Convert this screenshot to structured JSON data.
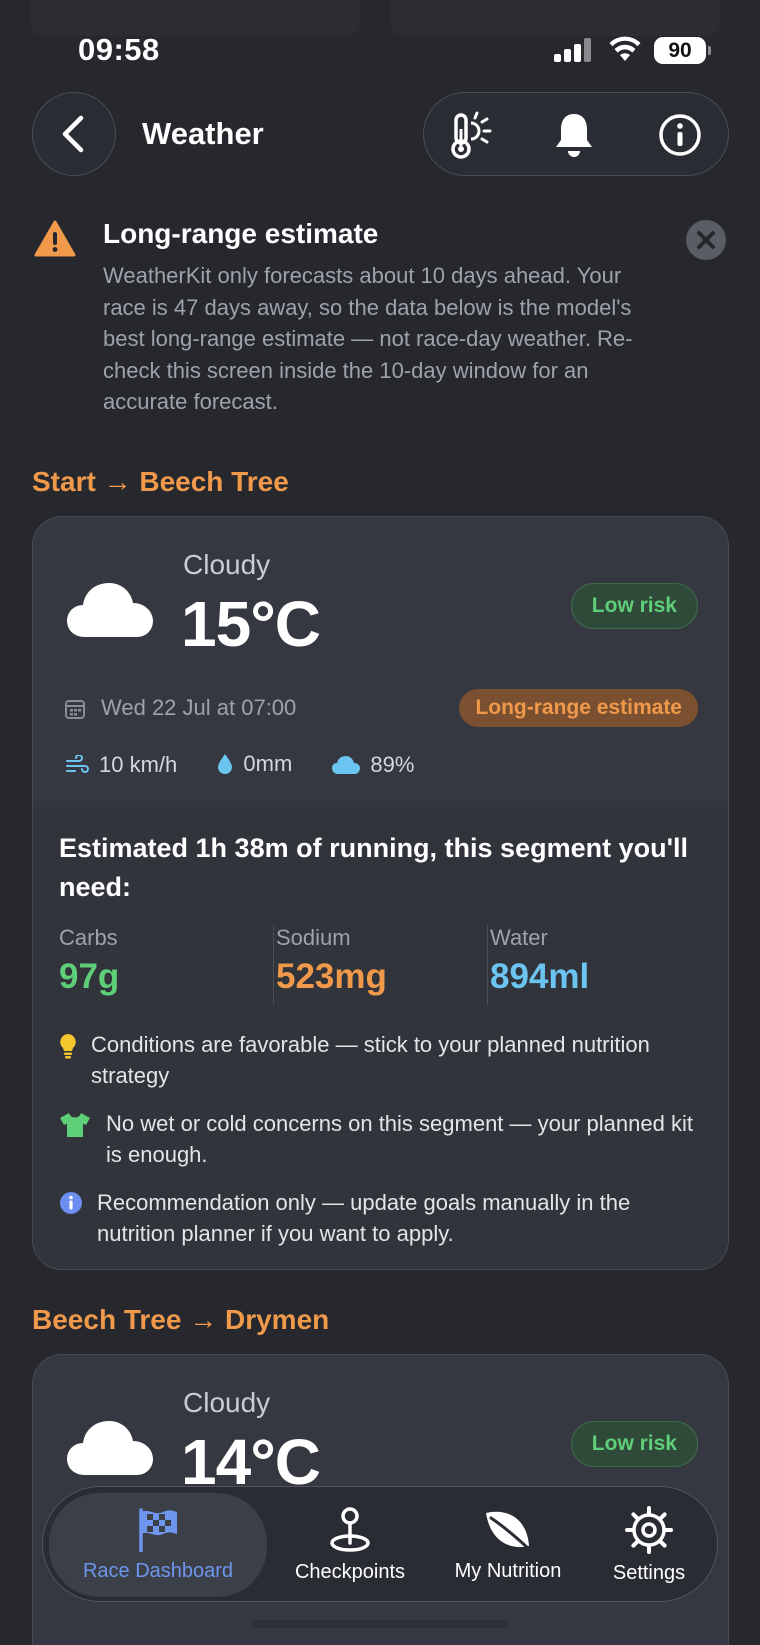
{
  "status_bar": {
    "time": "09:58",
    "battery": "90"
  },
  "header": {
    "title": "Weather"
  },
  "alert": {
    "title": "Long-range estimate",
    "body": "WeatherKit only forecasts about 10 days ahead. Your race is 47 days away, so the data below is the model's best long-range estimate — not race-day weather. Re-check this screen inside the 10-day window for an accurate forecast."
  },
  "segments": [
    {
      "heading": "Start → Beech Tree",
      "condition": "Cloudy",
      "temperature": "15°C",
      "risk": "Low risk",
      "datetime": "Wed 22 Jul at 07:00",
      "estimate_badge": "Long-range estimate",
      "wind": "10 km/h",
      "precip": "0mm",
      "cloud_cover": "89%",
      "estimate_text": "Estimated 1h 38m of running, this segment you'll need:",
      "nutrition": [
        {
          "label": "Carbs",
          "value": "97g",
          "color": "#5fce78"
        },
        {
          "label": "Sodium",
          "value": "523mg",
          "color": "#f0994a"
        },
        {
          "label": "Water",
          "value": "894ml",
          "color": "#6cc4f0"
        }
      ],
      "tips": [
        {
          "icon": "lightbulb-icon",
          "text": "Conditions are favorable — stick to your planned nutrition strategy"
        },
        {
          "icon": "tshirt-icon",
          "text": "No wet or cold concerns on this segment — your planned kit is enough."
        },
        {
          "icon": "info-icon",
          "text": "Recommendation only — update goals manually in the nutrition planner if you want to apply."
        }
      ]
    },
    {
      "heading": "Beech Tree → Drymen",
      "condition": "Cloudy",
      "temperature": "14°C",
      "risk": "Low risk"
    }
  ],
  "tabbar": {
    "tabs": [
      {
        "label": "Race Dashboard",
        "icon": "checkered-flag-icon",
        "active": true
      },
      {
        "label": "Checkpoints",
        "icon": "map-pin-icon",
        "active": false
      },
      {
        "label": "My Nutrition",
        "icon": "leaf-icon",
        "active": false
      },
      {
        "label": "Settings",
        "icon": "gear-icon",
        "active": false
      }
    ]
  },
  "colors": {
    "accent": "#f0994a",
    "risk_green": "#5fce78",
    "active_tab": "#6f96ee",
    "water": "#6cc4f0"
  }
}
